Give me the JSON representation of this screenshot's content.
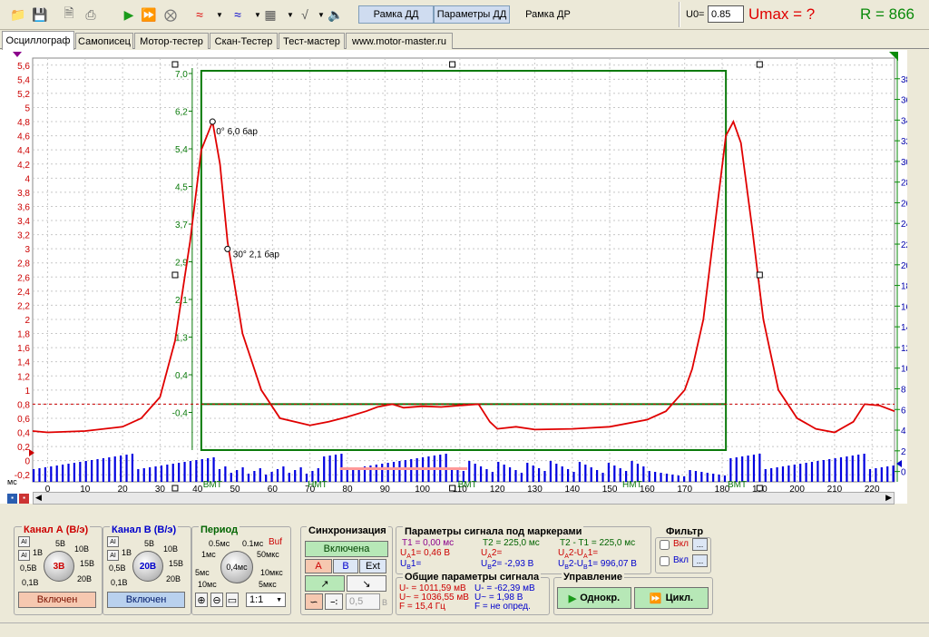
{
  "toolbar": {
    "frame_dd": "Рамка ДД",
    "params_dd": "Параметры ДД",
    "frame_dr": "Рамка ДР",
    "u0_label": "U0=",
    "u0_value": "0.85",
    "umax": "Umax = ?",
    "r_value": "R = 866"
  },
  "tabs": [
    "Осциллограф",
    "Самописец",
    "Мотор-тестер",
    "Скан-Тестер",
    "Тест-мастер",
    "www.motor-master.ru"
  ],
  "chart_data": {
    "type": "line",
    "x_unit": "мс",
    "xlim": [
      -4,
      226
    ],
    "x_ticks": [
      "0",
      "10",
      "20",
      "30",
      "40",
      "50",
      "60",
      "70",
      "80",
      "90",
      "100",
      "110",
      "120",
      "130",
      "140",
      "150",
      "160",
      "170",
      "180",
      "190",
      "200",
      "210",
      "220"
    ],
    "left_axis": {
      "ylim": [
        -0.3,
        5.7
      ],
      "ticks": [
        "-0,2",
        "0",
        "0,2",
        "0,4",
        "0,6",
        "0,8",
        "1",
        "1,2",
        "1,4",
        "1,6",
        "1,8",
        "2",
        "2,2",
        "2,4",
        "2,6",
        "2,8",
        "3",
        "3,2",
        "3,4",
        "3,6",
        "3,8",
        "4",
        "4,2",
        "4,4",
        "4,6",
        "4,8",
        "5",
        "5,2",
        "5,4",
        "5,6"
      ]
    },
    "right_axis": {
      "ylim": [
        -1,
        40
      ],
      "ticks": [
        "0",
        "2",
        "4",
        "6",
        "8",
        "10",
        "12",
        "14",
        "16",
        "18",
        "20",
        "22",
        "24",
        "26",
        "28",
        "30",
        "32",
        "34",
        "36",
        "38"
      ]
    },
    "pressure_axis": {
      "ticks": [
        "7,0",
        "6,2",
        "5,4",
        "4,5",
        "3,7",
        "2,9",
        "2,1",
        "1,3",
        "0,4",
        "-0,4"
      ]
    },
    "series": [
      {
        "name": "A",
        "color": "#e00000",
        "x": [
          -4,
          0,
          10,
          20,
          25,
          30,
          34,
          38,
          41,
          44,
          46,
          48,
          52,
          57,
          62,
          70,
          75,
          80,
          85,
          88,
          92,
          95,
          100,
          105,
          110,
          115,
          118,
          120,
          125,
          130,
          140,
          150,
          160,
          165,
          170,
          172,
          175,
          178,
          181,
          183,
          185,
          188,
          191,
          195,
          200,
          205,
          210,
          215,
          218,
          222,
          226
        ],
        "y": [
          0.42,
          0.4,
          0.42,
          0.48,
          0.6,
          0.9,
          1.7,
          3.1,
          4.4,
          4.8,
          4.2,
          3.1,
          1.8,
          1.0,
          0.6,
          0.5,
          0.55,
          0.62,
          0.7,
          0.76,
          0.8,
          0.75,
          0.77,
          0.76,
          0.78,
          0.8,
          0.55,
          0.45,
          0.48,
          0.44,
          0.45,
          0.48,
          0.58,
          0.7,
          1.0,
          1.3,
          2.0,
          3.3,
          4.6,
          4.8,
          4.5,
          3.3,
          2.0,
          1.0,
          0.6,
          0.45,
          0.4,
          0.55,
          0.8,
          0.78,
          0.7
        ]
      },
      {
        "name": "B",
        "color": "#0000e0"
      }
    ],
    "annotations": [
      "0° 6,0 бар",
      "30° 2,1 бар",
      "ВМТ",
      "НМТ",
      "ВМТ",
      "НМТ",
      "ВМТ"
    ],
    "threshold_u0": 0.8,
    "grid": true
  },
  "ch_a": {
    "title": "Канал А (В/э)",
    "range": "3В",
    "labels": [
      "5В",
      "10В",
      "15В",
      "20В",
      "1В",
      "0,5В",
      "0,1В"
    ],
    "status": "Включен",
    "color": "#cc0000"
  },
  "ch_b": {
    "title": "Канал В (В/э)",
    "range": "20В",
    "labels": [
      "5В",
      "10В",
      "15В",
      "20В",
      "1В",
      "0,5В",
      "0,1В"
    ],
    "status": "Включен",
    "color": "#0000cc"
  },
  "period": {
    "title": "Период",
    "value": "0,4мс",
    "labels": [
      "0.5мс",
      "0.1мс",
      "1мс",
      "50мкс",
      "5мс",
      "10мкс",
      "10мс",
      "5мкс"
    ],
    "buf": "Buf",
    "ratio": "1:1"
  },
  "sync": {
    "title": "Синхронизация",
    "status": "Включена",
    "a": "A",
    "b": "B",
    "ext": "Ext",
    "level": "0,5",
    "unit": "В"
  },
  "markers": {
    "title": "Параметры сигнала под маркерами",
    "t1": "T1 = 0,00 мс",
    "ua1": "= 0,46 В",
    "ub1": "=",
    "t2": "T2 = 225,0 мс",
    "ua2": "=",
    "ub2": "= -2,93 В",
    "dt": "T2 - T1 = 225,0 мс",
    "dua": "2-U",
    "dub": "2-U",
    "dub_val": "= 996,07 В"
  },
  "general": {
    "title": "Общие параметры сигнала",
    "a_lines": [
      "U- = 1011,59 мВ",
      "U~ = 1036,55 мВ",
      "F = 15,4 Гц"
    ],
    "b_lines": [
      "U- = -62,39 мВ",
      "U~ = 1,98 В",
      "F = не опред."
    ]
  },
  "filter": {
    "title": "Фильтр",
    "on1": "Вкл",
    "on2": "Вкл"
  },
  "control": {
    "title": "Управление",
    "single": "Однокр.",
    "cycle": "Цикл."
  }
}
